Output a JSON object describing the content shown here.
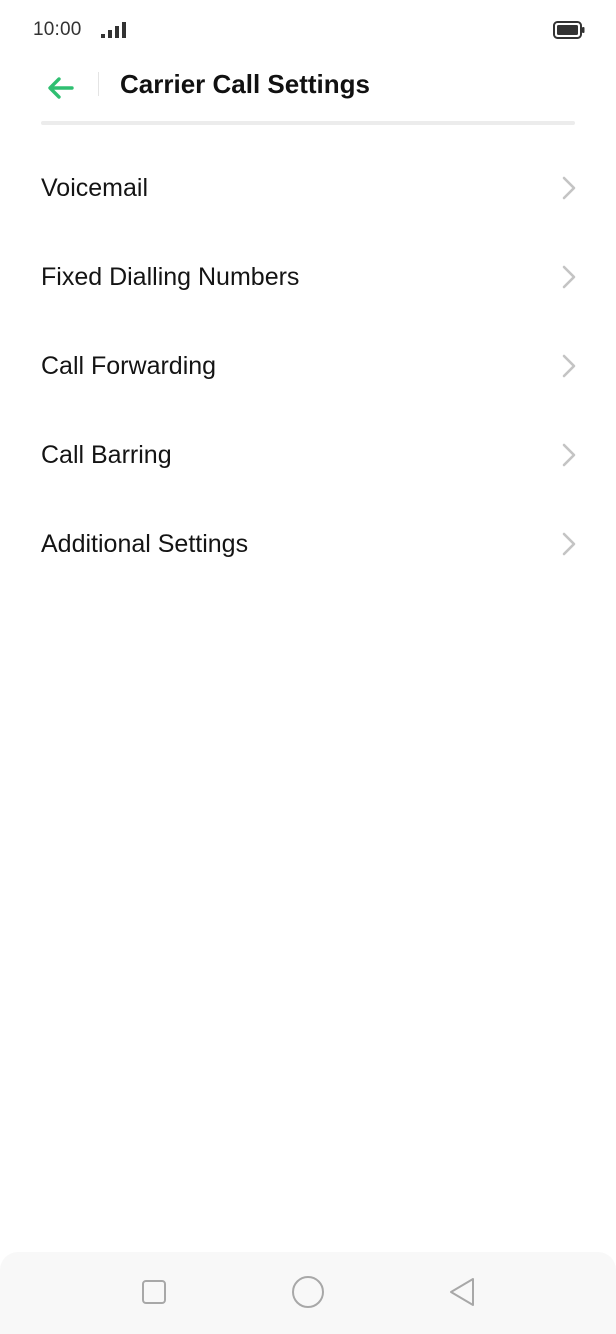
{
  "status_bar": {
    "time": "10:00",
    "signal_icon": "signal-bars-icon",
    "battery_icon": "battery-full-icon"
  },
  "header": {
    "title": "Carrier Call Settings",
    "back_icon": "arrow-left-icon",
    "accent_color": "#2fbf71"
  },
  "menu": {
    "items": [
      {
        "label": "Voicemail"
      },
      {
        "label": "Fixed Dialling Numbers"
      },
      {
        "label": "Call Forwarding"
      },
      {
        "label": "Call Barring"
      },
      {
        "label": "Additional Settings"
      }
    ]
  },
  "nav_bar": {
    "recents_icon": "square-icon",
    "home_icon": "circle-icon",
    "back_icon": "triangle-back-icon"
  }
}
